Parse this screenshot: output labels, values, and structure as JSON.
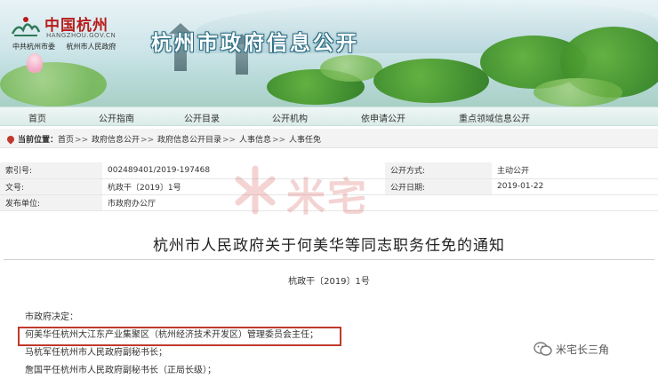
{
  "header": {
    "logo_title": "中国杭州",
    "logo_domain": "HANGZHOU.GOV.CN",
    "orgs": [
      "中共杭州市委",
      "杭州市人民政府"
    ],
    "site_title": "杭州市政府信息公开"
  },
  "nav": {
    "items": [
      "首页",
      "公开指南",
      "公开目录",
      "公开机构",
      "依申请公开",
      "重点领域信息公开"
    ]
  },
  "breadcrumb": {
    "label": "当前位置",
    "items": [
      "首页",
      "政府信息公开",
      "政府信息公开目录",
      "人事信息",
      "人事任免"
    ]
  },
  "meta": {
    "index_label": "索引号:",
    "index_value": "002489401/2019-197468",
    "open_mode_label": "公开方式:",
    "open_mode_value": "主动公开",
    "doc_label": "文号:",
    "doc_value": "杭政干〔2019〕1号",
    "date_label": "公开日期:",
    "date_value": "2019-01-22",
    "unit_label": "发布单位:",
    "unit_value": "市政府办公厅"
  },
  "watermark": "米宅",
  "document": {
    "title": "杭州市人民政府关于何美华等同志职务任免的通知",
    "number": "杭政干〔2019〕1号",
    "lines": [
      "市政府决定：",
      "何美华任杭州大江东产业集聚区（杭州经济技术开发区）管理委员会主任；",
      "马杭军任杭州市人民政府副秘书长；",
      "詹国平任杭州市人民政府副秘书长（正局长级）；"
    ]
  },
  "brand": "米宅长三角",
  "colors": {
    "accent": "#c0392b",
    "title_red": "#b81c1c"
  }
}
